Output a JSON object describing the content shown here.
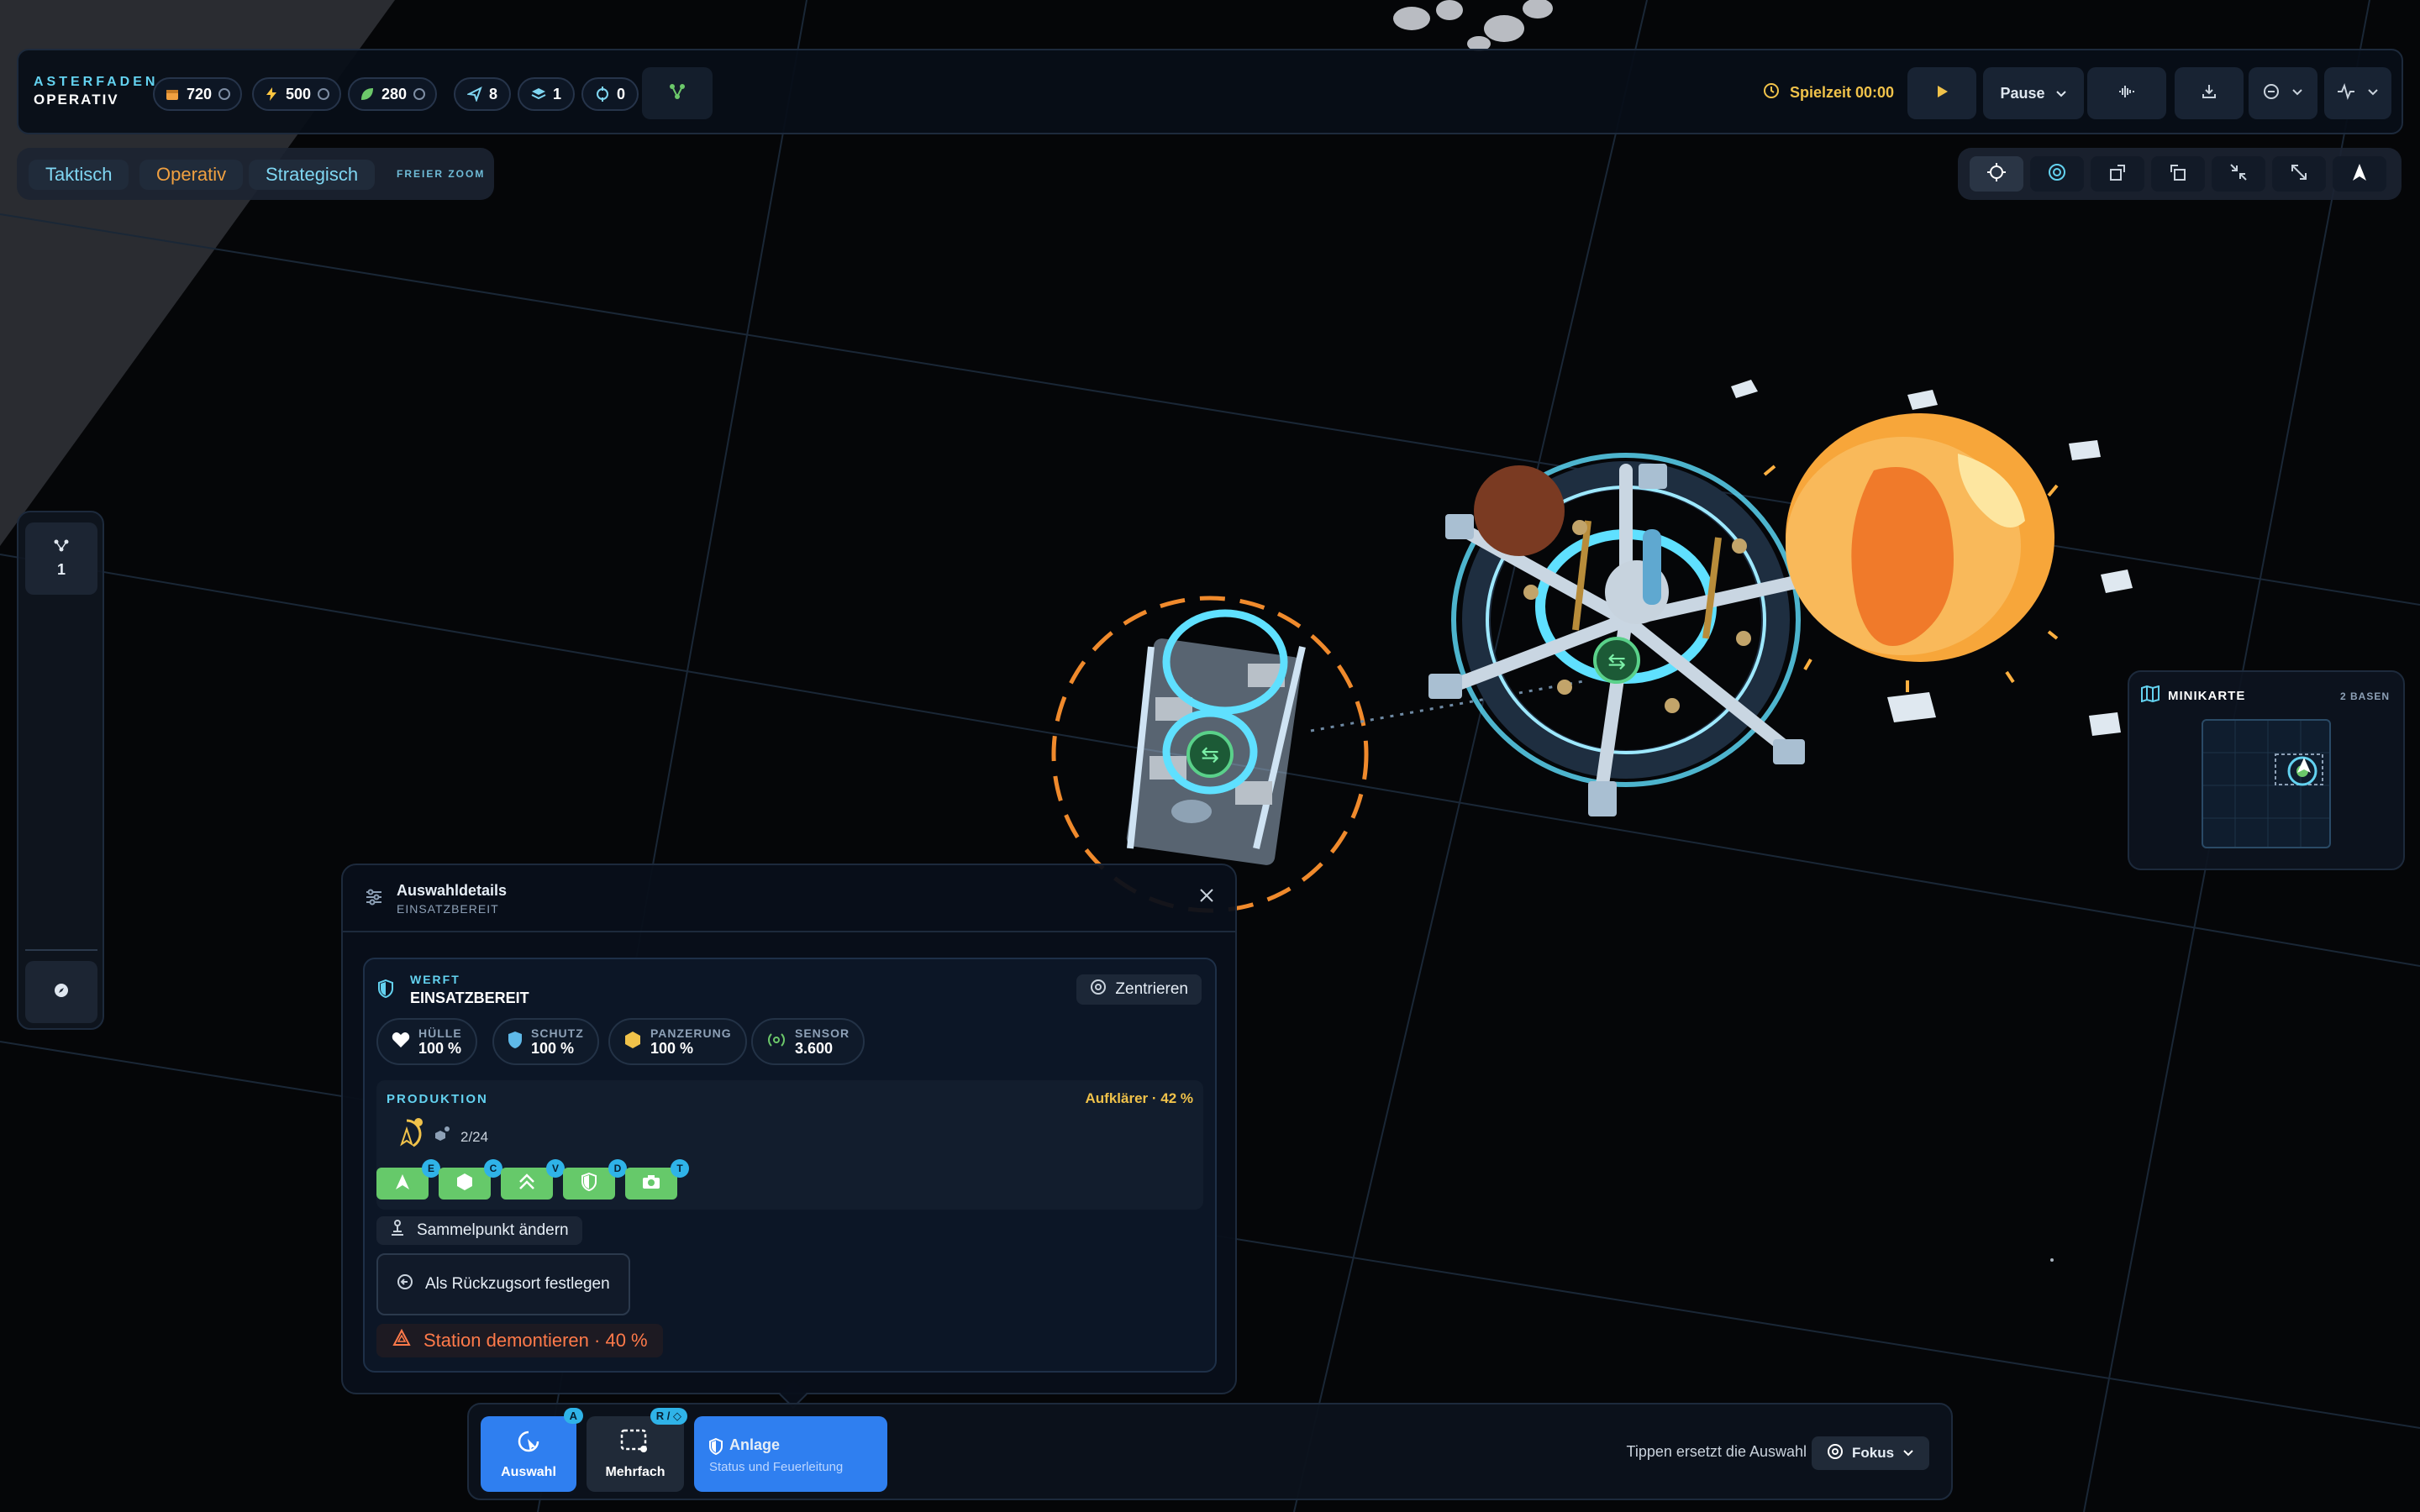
{
  "header": {
    "brand_top": "ASTERFADEN",
    "brand_bottom": "OPERATIV",
    "resources": [
      {
        "icon": "crate-icon",
        "value": "720",
        "color": "#f0a040"
      },
      {
        "icon": "energy-icon",
        "value": "500",
        "color": "#ffc640"
      },
      {
        "icon": "leaf-icon",
        "value": "280",
        "color": "#6cc86a"
      }
    ],
    "counters": [
      {
        "icon": "send-icon",
        "value": "8"
      },
      {
        "icon": "layers-icon",
        "value": "1"
      },
      {
        "icon": "target-icon",
        "value": "0"
      }
    ],
    "game_time_label": "Spielzeit 00:00",
    "pause_label": "Pause"
  },
  "zoom": {
    "tabs": [
      "Taktisch",
      "Operativ",
      "Strategisch"
    ],
    "active": "Operativ",
    "free_zoom": "FREIER ZOOM"
  },
  "left_rail": {
    "group_count": "1"
  },
  "minimap": {
    "title": "MINIKARTE",
    "bases": "2 BASEN"
  },
  "details": {
    "title": "Auswahldetails",
    "subtitle": "EINSATZBEREIT",
    "unit_type": "WERFT",
    "unit_status": "EINSATZBEREIT",
    "center_button": "Zentrieren",
    "stats": [
      {
        "label": "HÜLLE",
        "value": "100 %",
        "icon": "heart-icon"
      },
      {
        "label": "SCHUTZ",
        "value": "100 %",
        "icon": "shield-icon"
      },
      {
        "label": "PANZERUNG",
        "value": "100 %",
        "icon": "armor-icon"
      },
      {
        "label": "SENSOR",
        "value": "3.600",
        "icon": "sensor-icon"
      }
    ],
    "production": {
      "label": "PRODUKTION",
      "progress_label": "Aufklärer · 42 %",
      "queue_count": "2/24",
      "progress": 0.42,
      "queue": [
        {
          "icon": "scout-icon",
          "hotkey": "E"
        },
        {
          "icon": "hexagon-icon",
          "hotkey": "C"
        },
        {
          "icon": "chevrons-up-icon",
          "hotkey": "V"
        },
        {
          "icon": "half-shield-icon",
          "hotkey": "D"
        },
        {
          "icon": "camera-icon",
          "hotkey": "T"
        }
      ]
    },
    "rally_button": "Sammelpunkt ändern",
    "retreat_button": "Als Rückzugsort festlegen",
    "demolish_button": "Station demontieren · 40 %"
  },
  "bottom": {
    "tools": [
      {
        "label": "Auswahl",
        "hotkey": "A"
      },
      {
        "label": "Mehrfach",
        "hotkey": "R / ◇"
      }
    ],
    "mode_title": "Anlage",
    "mode_sub": "Status und Feuerleitung",
    "hint": "Tippen ersetzt die Auswahl",
    "focus_label": "Fokus"
  },
  "colors": {
    "accent": "#63d2f0",
    "active_zoom": "#f0a040",
    "selection_ring": "#f08a2c",
    "production": "#f0c24a",
    "demolish": "#ff7a4a",
    "queue_green": "#66c96a",
    "primary_blue": "#2f7ff0"
  }
}
